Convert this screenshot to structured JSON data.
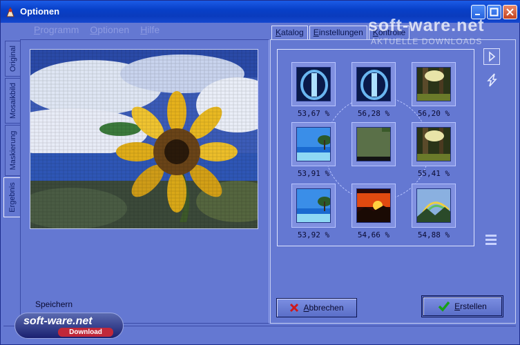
{
  "window": {
    "title": "Optionen"
  },
  "menu": {
    "items": [
      "Programm",
      "Optionen",
      "Hilfe"
    ]
  },
  "left_tabs": [
    "Original",
    "Mosaikbild",
    "Maskierung",
    "Ergebnis"
  ],
  "right_tabs": [
    "Katalog",
    "Einstellungen",
    "Kontrolle"
  ],
  "tiles": [
    {
      "percent": "53,67 %",
      "image": "blue-tunnel"
    },
    {
      "percent": "56,28 %",
      "image": "blue-tunnel"
    },
    {
      "percent": "56,20 %",
      "image": "forest"
    },
    {
      "percent": "53,91 %",
      "image": "tropical-island"
    },
    {
      "percent": "",
      "image": "target-block"
    },
    {
      "percent": "55,41 %",
      "image": "forest"
    },
    {
      "percent": "53,92 %",
      "image": "tropical-island"
    },
    {
      "percent": "54,66 %",
      "image": "sunset"
    },
    {
      "percent": "54,88 %",
      "image": "rainbow"
    }
  ],
  "labels": {
    "save": "Speichern"
  },
  "buttons": {
    "cancel": "Abbrechen",
    "create": "Erstellen"
  },
  "watermark": {
    "site": "soft-ware.net",
    "tagline": "AKTUELLE DOWNLOADS",
    "badge_title": "soft-ware.net",
    "badge_sub": "Download"
  }
}
